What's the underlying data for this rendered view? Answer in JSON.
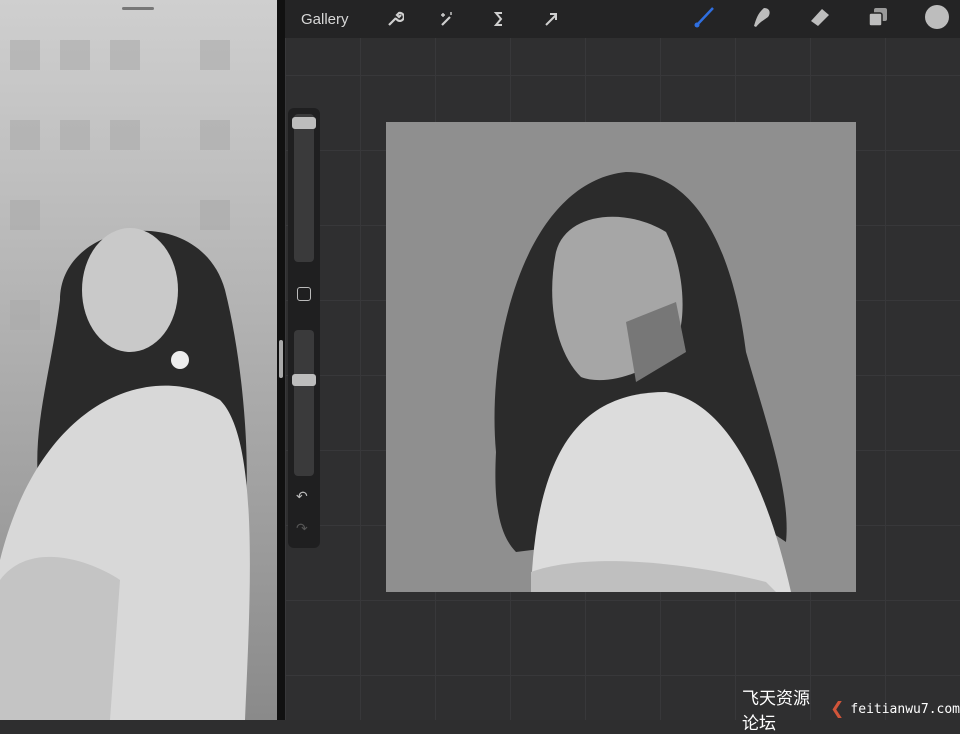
{
  "topbar": {
    "gallery_label": "Gallery",
    "left_tools": [
      "wrench-icon",
      "magic-wand-icon",
      "selection-icon",
      "transform-arrow-icon"
    ],
    "right_tools": [
      "brush-icon",
      "smudge-icon",
      "eraser-icon",
      "layers-icon",
      "color-swatch"
    ]
  },
  "colors": {
    "brush_active": "#2f6fe0",
    "current_color": "#bdbdbd"
  },
  "sidebar": {
    "undo_glyph": "↶",
    "redo_glyph": "↷"
  },
  "watermark": {
    "text": "飞天资源论坛",
    "url": "feitianwu7.com"
  }
}
